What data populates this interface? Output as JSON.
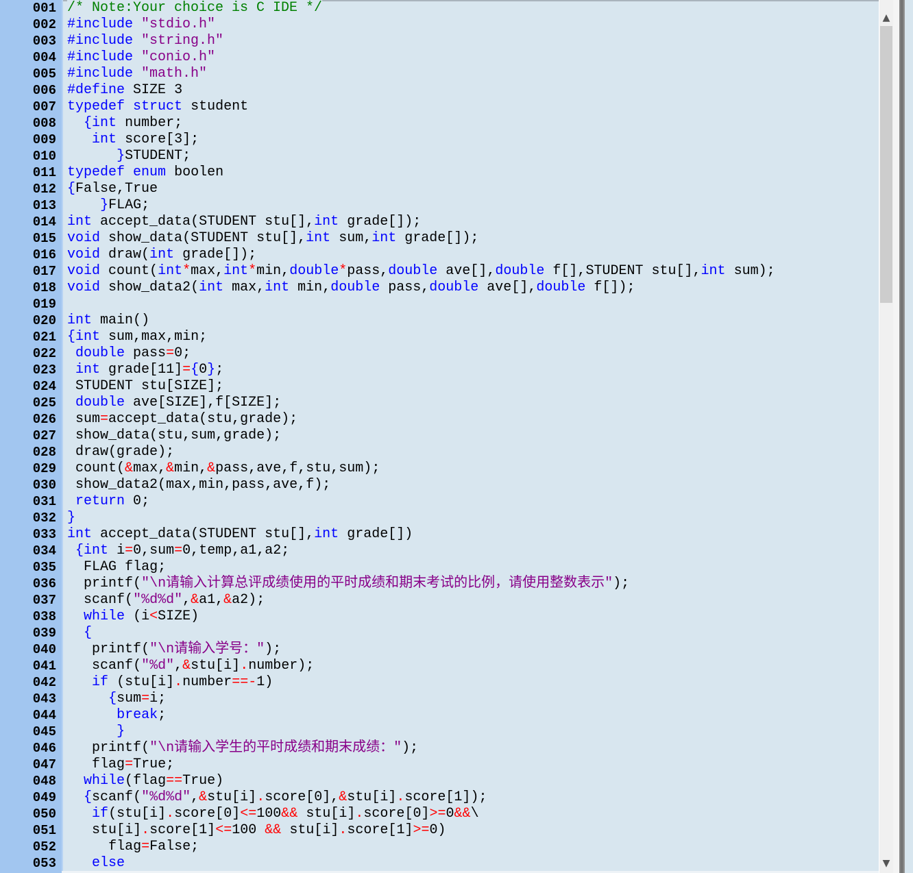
{
  "colors": {
    "keyword": "#0000ff",
    "string": "#880088",
    "comment": "#008000",
    "operator": "#ff0000",
    "gutter": "#a2c6f0",
    "background": "#d8e6ef"
  },
  "scrollbar": {
    "up_icon": "▲",
    "down_icon": "▼"
  },
  "lines": [
    {
      "num": "001",
      "text": "/* Note:Your choice is C IDE */"
    },
    {
      "num": "002",
      "text": "#include \"stdio.h\""
    },
    {
      "num": "003",
      "text": "#include \"string.h\""
    },
    {
      "num": "004",
      "text": "#include \"conio.h\""
    },
    {
      "num": "005",
      "text": "#include \"math.h\""
    },
    {
      "num": "006",
      "text": "#define SIZE 3"
    },
    {
      "num": "007",
      "text": "typedef struct student"
    },
    {
      "num": "008",
      "text": "  {int number;"
    },
    {
      "num": "009",
      "text": "   int score[3];"
    },
    {
      "num": "010",
      "text": "      }STUDENT;"
    },
    {
      "num": "011",
      "text": "typedef enum boolen"
    },
    {
      "num": "012",
      "text": "{False,True"
    },
    {
      "num": "013",
      "text": "    }FLAG;"
    },
    {
      "num": "014",
      "text": "int accept_data(STUDENT stu[],int grade[]);"
    },
    {
      "num": "015",
      "text": "void show_data(STUDENT stu[],int sum,int grade[]);"
    },
    {
      "num": "016",
      "text": "void draw(int grade[]);"
    },
    {
      "num": "017",
      "text": "void count(int*max,int*min,double*pass,double ave[],double f[],STUDENT stu[],int sum);"
    },
    {
      "num": "018",
      "text": "void show_data2(int max,int min,double pass,double ave[],double f[]);"
    },
    {
      "num": "019",
      "text": ""
    },
    {
      "num": "020",
      "text": "int main()"
    },
    {
      "num": "021",
      "text": "{int sum,max,min;"
    },
    {
      "num": "022",
      "text": " double pass=0;"
    },
    {
      "num": "023",
      "text": " int grade[11]={0};"
    },
    {
      "num": "024",
      "text": " STUDENT stu[SIZE];"
    },
    {
      "num": "025",
      "text": " double ave[SIZE],f[SIZE];"
    },
    {
      "num": "026",
      "text": " sum=accept_data(stu,grade);"
    },
    {
      "num": "027",
      "text": " show_data(stu,sum,grade);"
    },
    {
      "num": "028",
      "text": " draw(grade);"
    },
    {
      "num": "029",
      "text": " count(&max,&min,&pass,ave,f,stu,sum);"
    },
    {
      "num": "030",
      "text": " show_data2(max,min,pass,ave,f);"
    },
    {
      "num": "031",
      "text": " return 0;"
    },
    {
      "num": "032",
      "text": "}"
    },
    {
      "num": "033",
      "text": "int accept_data(STUDENT stu[],int grade[])"
    },
    {
      "num": "034",
      "text": " {int i=0,sum=0,temp,a1,a2;"
    },
    {
      "num": "035",
      "text": "  FLAG flag;"
    },
    {
      "num": "036",
      "text": "  printf(\"\\n请输入计算总评成绩使用的平时成绩和期末考试的比例，请使用整数表示\");"
    },
    {
      "num": "037",
      "text": "  scanf(\"%d%d\",&a1,&a2);"
    },
    {
      "num": "038",
      "text": "  while (i<SIZE)"
    },
    {
      "num": "039",
      "text": "  {"
    },
    {
      "num": "040",
      "text": "   printf(\"\\n请输入学号：\");"
    },
    {
      "num": "041",
      "text": "   scanf(\"%d\",&stu[i].number);"
    },
    {
      "num": "042",
      "text": "   if (stu[i].number==-1)"
    },
    {
      "num": "043",
      "text": "     {sum=i;"
    },
    {
      "num": "044",
      "text": "      break;"
    },
    {
      "num": "045",
      "text": "      }"
    },
    {
      "num": "046",
      "text": "   printf(\"\\n请输入学生的平时成绩和期末成绩：\");"
    },
    {
      "num": "047",
      "text": "   flag=True;"
    },
    {
      "num": "048",
      "text": "  while(flag==True)"
    },
    {
      "num": "049",
      "text": "  {scanf(\"%d%d\",&stu[i].score[0],&stu[i].score[1]);"
    },
    {
      "num": "050",
      "text": "   if(stu[i].score[0]<=100&& stu[i].score[0]>=0&&\\"
    },
    {
      "num": "051",
      "text": "   stu[i].score[1]<=100 && stu[i].score[1]>=0)"
    },
    {
      "num": "052",
      "text": "     flag=False;"
    },
    {
      "num": "053",
      "text": "   else"
    }
  ]
}
